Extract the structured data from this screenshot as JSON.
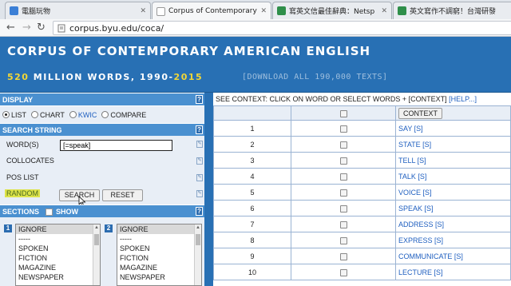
{
  "browser": {
    "tabs": [
      {
        "label": "電腦玩物",
        "icon": "blogger-favicon-icon",
        "color": "#3b7fd6"
      },
      {
        "label": "Corpus of Contemporary",
        "icon": "page-favicon-icon",
        "color": "#888888"
      },
      {
        "label": "寫英文信最佳辭典：Netsp",
        "icon": "site-favicon-icon",
        "color": "#2f8f4a"
      },
      {
        "label": "英文寫作不調窮！台灣研發",
        "icon": "site-favicon-icon",
        "color": "#2f8f4a"
      }
    ],
    "url": "corpus.byu.edu/coca/"
  },
  "header": {
    "title": "CORPUS OF CONTEMPORARY AMERICAN ENGLISH",
    "count": "520",
    "subtitle_middle": " MILLION WORDS, 1990-",
    "year": "2015",
    "download": "[DOWNLOAD ALL 190,000 TEXTS]"
  },
  "display": {
    "heading": "DISPLAY",
    "options": [
      "LIST",
      "CHART",
      "KWIC",
      "COMPARE"
    ],
    "selected": "LIST"
  },
  "search": {
    "heading": "SEARCH STRING",
    "word_label": "WORD(S)",
    "word_value": "[=speak]",
    "collocates_label": "COLLOCATES",
    "pos_label": "POS LIST",
    "random_label": "RANDOM",
    "search_button": "SEARCH",
    "reset_button": "RESET"
  },
  "sections": {
    "heading": "SECTIONS",
    "show_label": "SHOW",
    "list1_num": "1",
    "list2_num": "2",
    "items": [
      "IGNORE",
      "-----",
      "SPOKEN",
      "FICTION",
      "MAGAZINE",
      "NEWSPAPER"
    ]
  },
  "results": {
    "context_instruction": "SEE CONTEXT: CLICK ON WORD OR SELECT WORDS + [CONTEXT]",
    "help": "[HELP...]",
    "context_button": "CONTEXT",
    "rows": [
      {
        "num": "1",
        "word": "SAY [S]"
      },
      {
        "num": "2",
        "word": "STATE [S]"
      },
      {
        "num": "3",
        "word": "TELL [S]"
      },
      {
        "num": "4",
        "word": "TALK [S]"
      },
      {
        "num": "5",
        "word": "VOICE [S]"
      },
      {
        "num": "6",
        "word": "SPEAK [S]"
      },
      {
        "num": "7",
        "word": "ADDRESS [S]"
      },
      {
        "num": "8",
        "word": "EXPRESS [S]"
      },
      {
        "num": "9",
        "word": "COMMUNICATE [S]"
      },
      {
        "num": "10",
        "word": "LECTURE [S]"
      }
    ]
  },
  "colors": {
    "header_blue": "#2870b4",
    "section_blue": "#4a90d0",
    "accent_yellow": "#f3d735",
    "link_blue": "#2060c0"
  }
}
